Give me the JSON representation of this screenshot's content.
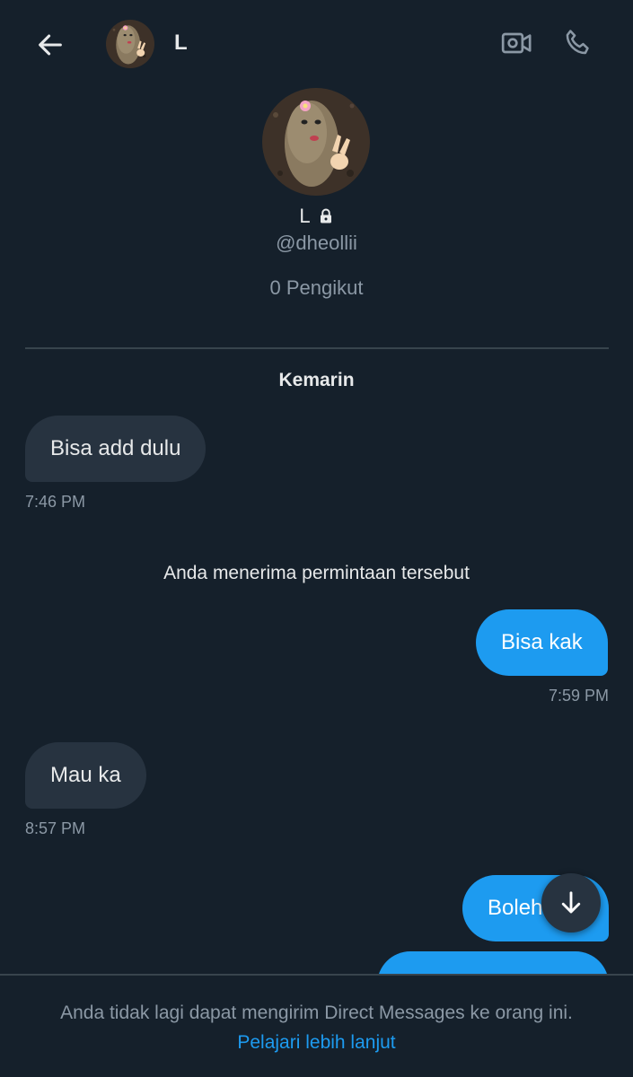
{
  "header": {
    "contact_name": "L",
    "back_icon": "arrow-left-icon",
    "video_icon": "video-camera-icon",
    "call_icon": "phone-icon"
  },
  "profile": {
    "name": "L",
    "lock_icon": "lock-icon",
    "handle": "@dheollii",
    "followers": "0 Pengikut"
  },
  "conversation": {
    "date_label": "Kemarin",
    "messages": [
      {
        "direction": "incoming",
        "text": "Bisa add dulu",
        "time": "7:46 PM"
      },
      {
        "direction": "system",
        "text": "Anda menerima permintaan tersebut"
      },
      {
        "direction": "outgoing",
        "text": "Bisa kak",
        "time": "7:59 PM"
      },
      {
        "direction": "incoming",
        "text": "Mau ka",
        "time": "8:57 PM"
      },
      {
        "direction": "outgoing",
        "text": "Boleh"
      },
      {
        "direction": "outgoing",
        "text": ""
      }
    ]
  },
  "scroll_down_icon": "arrow-down-icon",
  "footer": {
    "notice": "Anda tidak lagi dapat mengirim Direct Messages ke orang ini.",
    "learn_more": "Pelajari lebih lanjut"
  },
  "colors": {
    "background": "#15202b",
    "incoming_bubble": "#273340",
    "outgoing_bubble": "#1d9bf0",
    "muted_text": "#8b98a5",
    "link": "#1d9bf0"
  }
}
